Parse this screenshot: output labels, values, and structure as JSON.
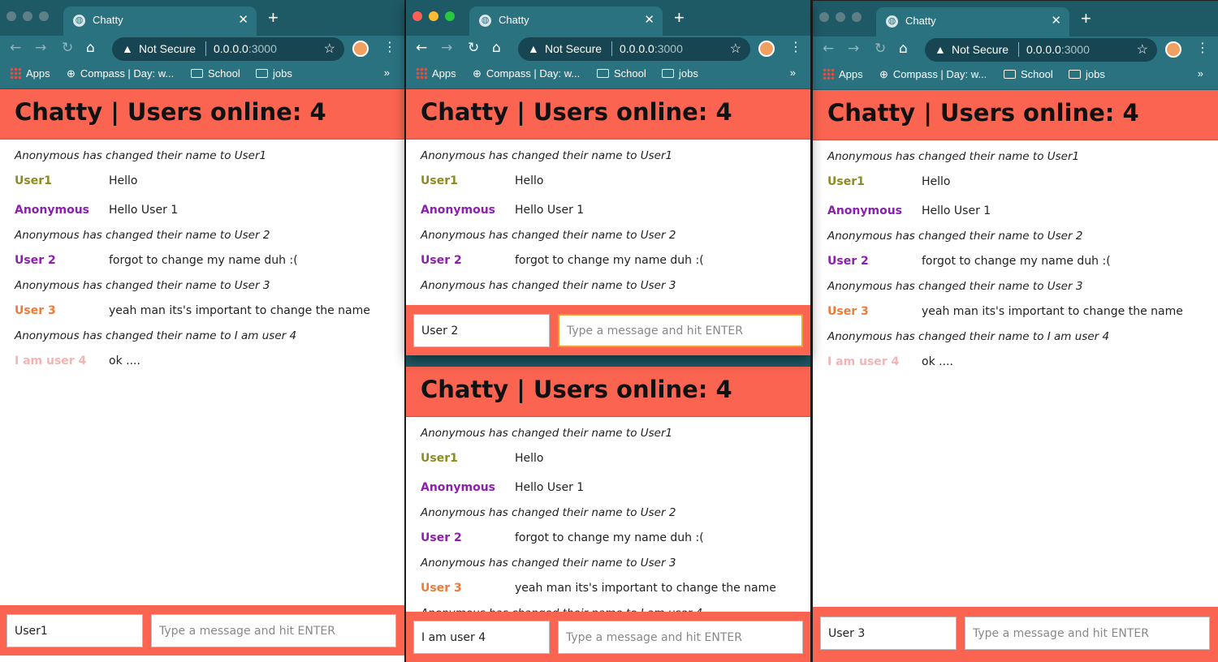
{
  "colors": {
    "header_bg": "#fb6450",
    "tab_bar": "#1e5a66",
    "toolbar": "#2a7280",
    "user1": "#8b8b1f",
    "anonymous": "#8c1fb0",
    "user2": "#8c1fb0",
    "user3": "#ef7a37",
    "user4": "#f5b4b4"
  },
  "browser": {
    "tab_title": "Chatty",
    "close_glyph": "✕",
    "new_tab_glyph": "+",
    "security_label": "Not Secure",
    "url_host": "0.0.0.0",
    "url_port": ":3000",
    "bookmarks": [
      "Apps",
      "Compass | Day: w...",
      "School",
      "jobs"
    ],
    "more_glyph": "»"
  },
  "app": {
    "title": "Chatty | Users online: 4",
    "placeholder": "Type a message and hit ENTER"
  },
  "messages": [
    {
      "type": "system",
      "text": "Anonymous has changed their name to User1"
    },
    {
      "type": "chat",
      "user": "User1",
      "text": "Hello"
    },
    {
      "type": "chat",
      "user": "Anonymous",
      "text": "Hello User 1"
    },
    {
      "type": "system",
      "text": "Anonymous has changed their name to User 2"
    },
    {
      "type": "chat",
      "user": "User 2",
      "text": "forgot to change my name duh :("
    },
    {
      "type": "system",
      "text": "Anonymous has changed their name to User 3"
    },
    {
      "type": "chat",
      "user": "User 3",
      "text": "yeah man its's important to change the name"
    },
    {
      "type": "system",
      "text": "Anonymous has changed their name to I am user 4"
    },
    {
      "type": "chat",
      "user": "I am user 4",
      "text": "ok ...."
    }
  ],
  "windows": {
    "left_username": "User1",
    "middle_top_username": "User 2",
    "middle_bottom_username": "I am user 4",
    "right_username": "User 3"
  }
}
